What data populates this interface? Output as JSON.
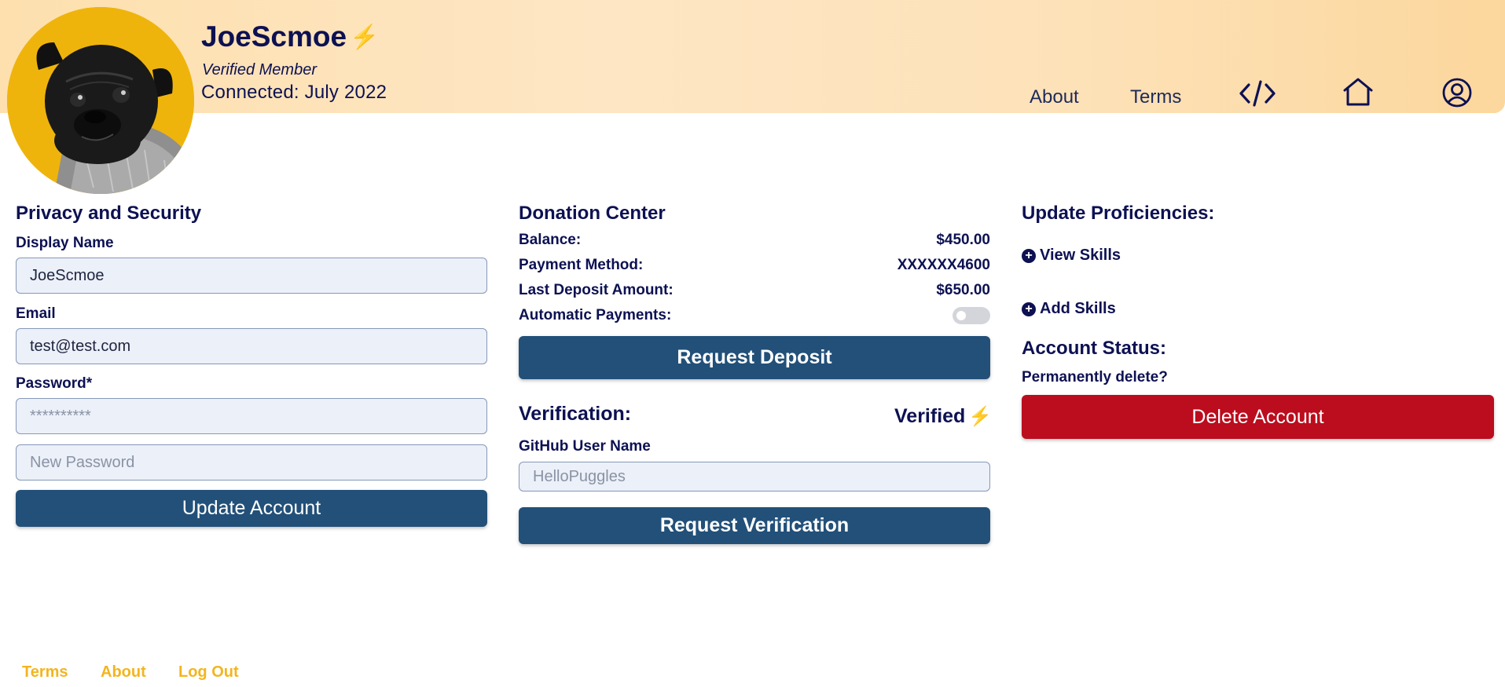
{
  "header": {
    "username": "JoeScmoe",
    "member_tag": "Verified Member",
    "connected": "Connected: July 2022",
    "bolt": "⚡",
    "nav": {
      "about": "About",
      "terms": "Terms"
    },
    "icons": [
      "code-icon",
      "home-icon",
      "user-account-icon"
    ]
  },
  "privacy": {
    "title": "Privacy and Security",
    "display_name_label": "Display Name",
    "display_name_value": "JoeScmoe",
    "email_label": "Email",
    "email_value": "test@test.com",
    "password_label": "Password*",
    "password_placeholder": "**********",
    "new_password_placeholder": "New Password",
    "update_button": "Update Account"
  },
  "donation": {
    "title": "Donation Center",
    "balance_label": "Balance:",
    "balance_value": "$450.00",
    "payment_method_label": "Payment Method:",
    "payment_method_value": "XXXXXX4600",
    "last_deposit_label": "Last Deposit Amount:",
    "last_deposit_value": "$650.00",
    "auto_payments_label": "Automatic Payments:",
    "auto_payments_enabled": false,
    "request_deposit_button": "Request Deposit"
  },
  "verification": {
    "title": "Verification:",
    "status": "Verified",
    "github_label": "GitHub User Name",
    "github_placeholder": "HelloPuggles",
    "request_button": "Request Verification"
  },
  "proficiencies": {
    "title": "Update Proficiencies:",
    "view_skills": "View Skills",
    "add_skills": "Add Skills"
  },
  "account_status": {
    "title": "Account Status:",
    "delete_prompt": "Permanently delete?",
    "delete_button": "Delete Account"
  },
  "footer": {
    "terms": "Terms",
    "about": "About",
    "logout": "Log Out"
  },
  "colors": {
    "navy": "#0d1152",
    "button_blue": "#225079",
    "danger_red": "#bb0d1e",
    "accent_gold": "#f3b51e",
    "avatar_bg": "#efb40c"
  }
}
